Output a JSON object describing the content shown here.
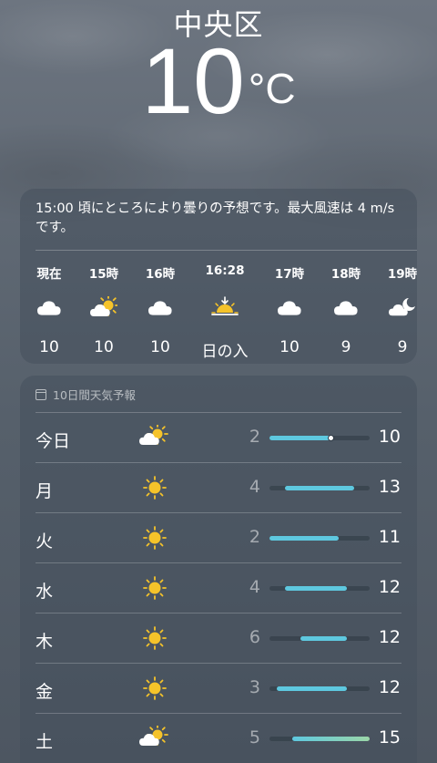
{
  "location": "中央区",
  "current": {
    "temperature": "10",
    "unit": "°C"
  },
  "summary": "15:00 頃にところにより曇りの予想です。最大風速は 4 m/s です。",
  "hourly": [
    {
      "time": "現在",
      "icon": "cloud-icon",
      "value": "10"
    },
    {
      "time": "15時",
      "icon": "partly-sunny-icon",
      "value": "10"
    },
    {
      "time": "16時",
      "icon": "cloud-icon",
      "value": "10"
    },
    {
      "time": "16:28",
      "icon": "sunset-icon",
      "value": "日の入"
    },
    {
      "time": "17時",
      "icon": "cloud-icon",
      "value": "10"
    },
    {
      "time": "18時",
      "icon": "cloud-icon",
      "value": "9"
    },
    {
      "time": "19時",
      "icon": "partly-cloudy-night-icon",
      "value": "9"
    }
  ],
  "daily_title": "10日間天気予報",
  "range": {
    "min": 2,
    "max": 15
  },
  "current_temp_value": 10,
  "daily": [
    {
      "day": "今日",
      "icon": "partly-sunny-icon",
      "low": "2",
      "high": "10",
      "show_current": true
    },
    {
      "day": "月",
      "icon": "sun-icon",
      "low": "4",
      "high": "13"
    },
    {
      "day": "火",
      "icon": "sun-icon",
      "low": "2",
      "high": "11"
    },
    {
      "day": "水",
      "icon": "sun-icon",
      "low": "4",
      "high": "12"
    },
    {
      "day": "木",
      "icon": "sun-icon",
      "low": "6",
      "high": "12"
    },
    {
      "day": "金",
      "icon": "sun-icon",
      "low": "3",
      "high": "12"
    },
    {
      "day": "土",
      "icon": "partly-sunny-icon",
      "low": "5",
      "high": "15"
    }
  ],
  "colors": {
    "bar": "#5ec8df",
    "bar_warm": "#9bd6a8",
    "sun": "#f5c32a"
  }
}
